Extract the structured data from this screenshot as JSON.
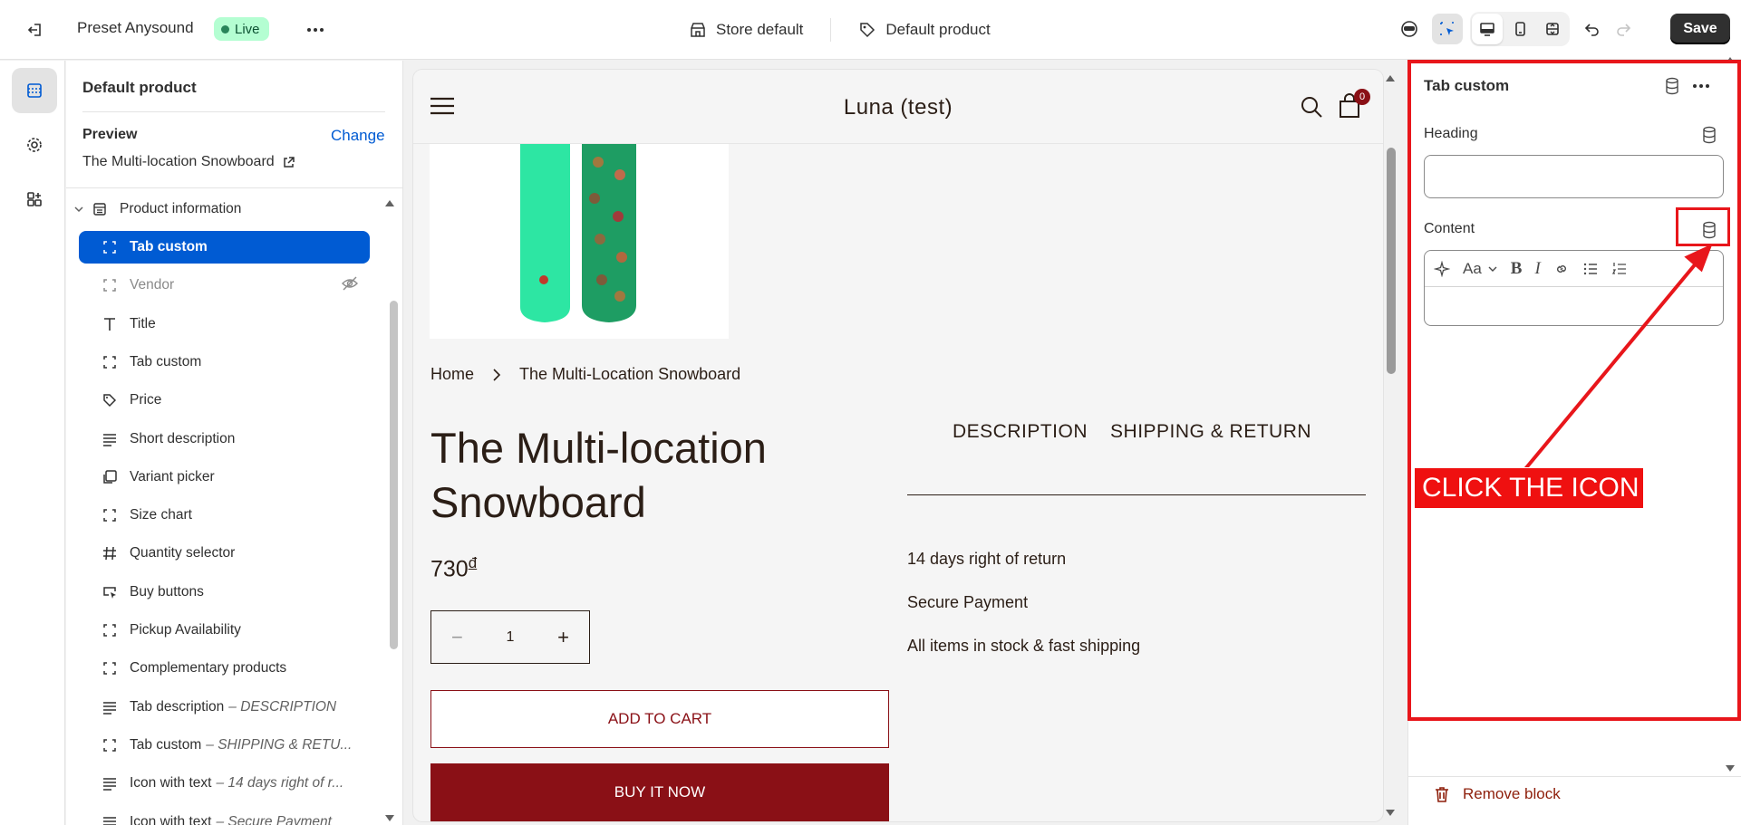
{
  "topbar": {
    "theme_name": "Preset Anysound",
    "live_label": "Live",
    "store_label": "Store default",
    "product_label": "Default product",
    "save_label": "Save"
  },
  "sidebar": {
    "title": "Default product",
    "preview_label": "Preview",
    "change_label": "Change",
    "preview_product": "The Multi-location Snowboard",
    "group_label": "Product information",
    "items": [
      {
        "label": "Tab custom",
        "suffix": "",
        "icon": "tab-block-icon",
        "selected": true
      },
      {
        "label": "Vendor",
        "suffix": "",
        "icon": "tab-block-icon",
        "hidden": true
      },
      {
        "label": "Title",
        "suffix": "",
        "icon": "text-icon"
      },
      {
        "label": "Tab custom",
        "suffix": "",
        "icon": "tab-block-icon"
      },
      {
        "label": "Price",
        "suffix": "",
        "icon": "price-tag-icon"
      },
      {
        "label": "Short description",
        "suffix": "",
        "icon": "paragraph-icon"
      },
      {
        "label": "Variant picker",
        "suffix": "",
        "icon": "variant-icon"
      },
      {
        "label": "Size chart",
        "suffix": "",
        "icon": "tab-block-icon"
      },
      {
        "label": "Quantity selector",
        "suffix": "",
        "icon": "hash-icon"
      },
      {
        "label": "Buy buttons",
        "suffix": "",
        "icon": "cursor-button-icon"
      },
      {
        "label": "Pickup Availability",
        "suffix": "",
        "icon": "tab-block-icon"
      },
      {
        "label": "Complementary products",
        "suffix": "",
        "icon": "tab-block-icon"
      },
      {
        "label": "Tab description",
        "suffix": "– DESCRIPTION",
        "icon": "paragraph-icon"
      },
      {
        "label": "Tab custom",
        "suffix": "– SHIPPING & RETU...",
        "icon": "tab-block-icon"
      },
      {
        "label": "Icon with text",
        "suffix": "– 14 days right of r...",
        "icon": "paragraph-icon"
      },
      {
        "label": "Icon with text",
        "suffix": "– Secure Payment",
        "icon": "paragraph-icon"
      }
    ]
  },
  "store": {
    "title": "Luna (test)",
    "cart_count": "0",
    "breadcrumb_home": "Home",
    "breadcrumb_current": "The Multi-Location Snowboard",
    "product_title": "The Multi-location Snowboard",
    "price": "730",
    "currency": "đ",
    "quantity": "1",
    "add_to_cart": "ADD TO CART",
    "buy_now": "BUY IT NOW",
    "tab_description": "DESCRIPTION",
    "tab_shipping": "SHIPPING & RETURN",
    "info_lines": [
      "14 days right of return",
      "Secure Payment",
      "All items in stock & fast shipping"
    ]
  },
  "panel": {
    "title": "Tab custom",
    "heading_label": "Heading",
    "heading_value": "",
    "content_label": "Content",
    "font_label": "Aa",
    "remove_label": "Remove block"
  },
  "annotation": {
    "callout": "CLICK THE ICON",
    "color": "#e8161b"
  }
}
